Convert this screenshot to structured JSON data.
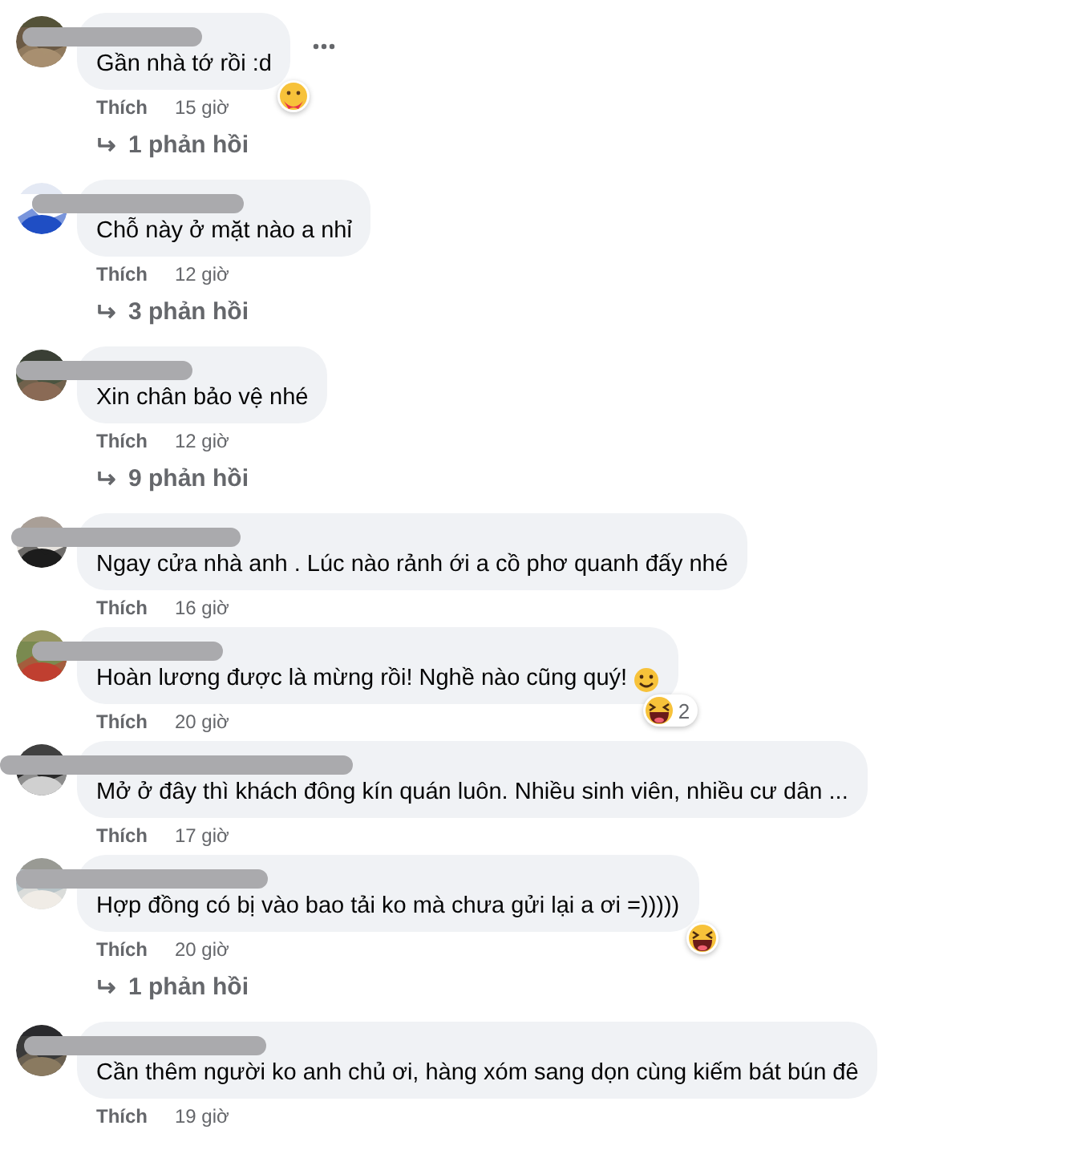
{
  "comments": [
    {
      "text": "Gần nhà tớ rồi :d",
      "more_menu": true,
      "like": "Thích",
      "time": "15 giờ",
      "reaction": {
        "kind": "care"
      },
      "replies": "1 phản hồi"
    },
    {
      "text": "Chỗ này ở mặt nào a nhỉ",
      "like": "Thích",
      "time": "12 giờ",
      "replies": "3 phản hồi"
    },
    {
      "text": "Xin chân bảo vệ nhé",
      "like": "Thích",
      "time": "12 giờ",
      "replies": "9 phản hồi"
    },
    {
      "text": "Ngay cửa nhà anh . Lúc nào rảnh ới a cồ phơ quanh đấy nhé",
      "like": "Thích",
      "time": "16 giờ"
    },
    {
      "text": "Hoàn lương được là mừng rồi! Nghề nào cũng quý!",
      "inline_emoji": {
        "kind": "smile"
      },
      "like": "Thích",
      "time": "20 giờ",
      "reaction": {
        "kind": "haha",
        "count": "2"
      }
    },
    {
      "text": "Mở ở đây thì khách đông kín quán luôn. Nhiều sinh viên, nhiều cư dân ...",
      "like": "Thích",
      "time": "17 giờ"
    },
    {
      "text": "Hợp đồng có bị vào bao tải ko mà chưa gửi lại a ơi =)))))",
      "like": "Thích",
      "time": "20 giờ",
      "reaction": {
        "kind": "haha"
      },
      "replies": "1 phản hồi"
    },
    {
      "text": "Cần thêm người ko anh chủ ơi, hàng xóm sang dọn cùng kiếm bát bún đê",
      "like": "Thích",
      "time": "19 giờ"
    }
  ]
}
